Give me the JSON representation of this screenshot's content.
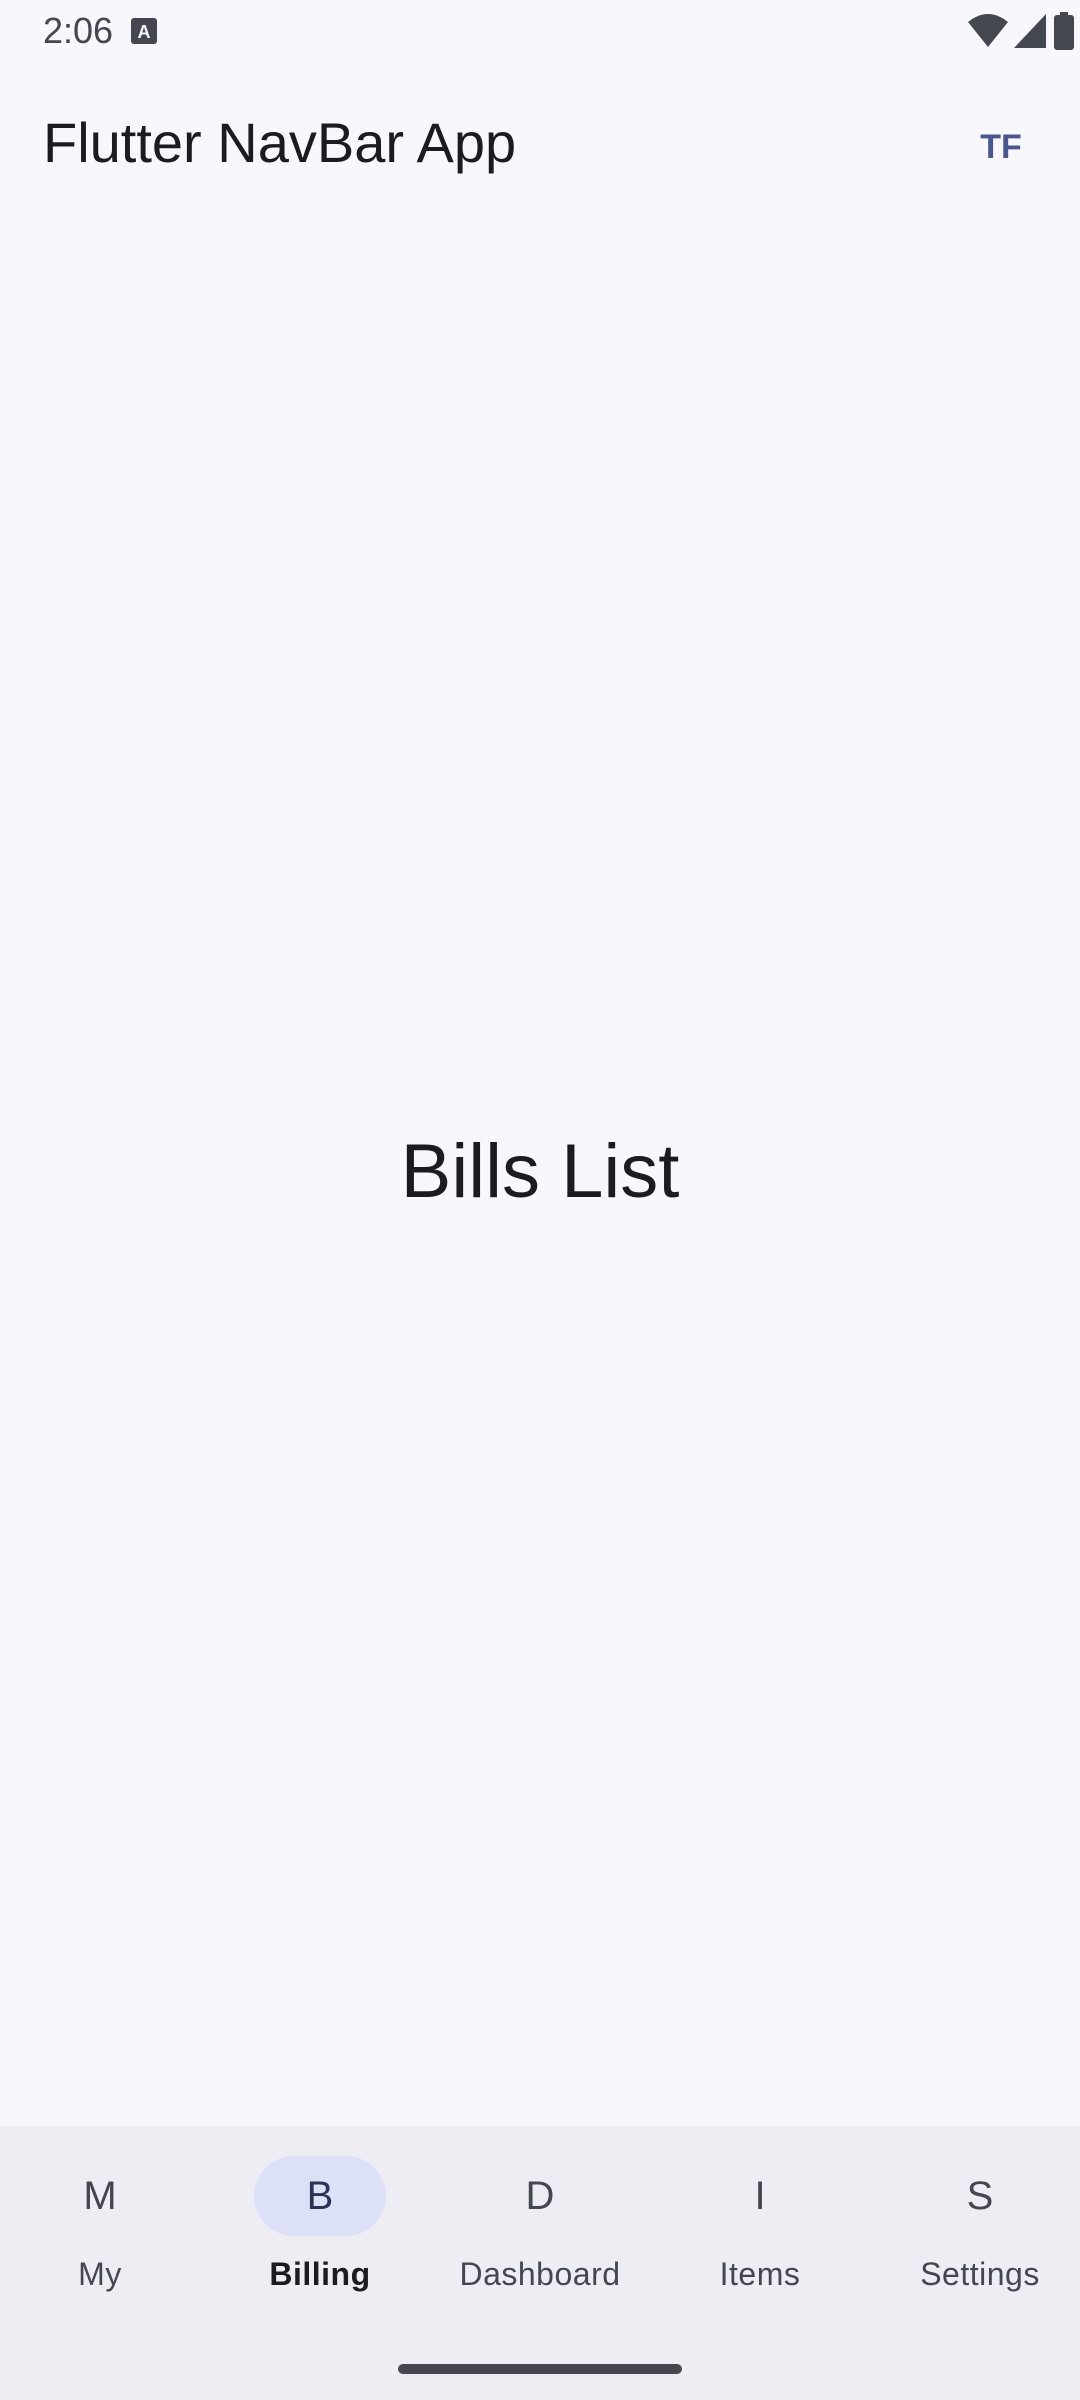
{
  "status_bar": {
    "time": "2:06",
    "icons": [
      "keyboard-a-icon",
      "wifi-icon",
      "signal-icon",
      "battery-icon"
    ]
  },
  "app_bar": {
    "title": "Flutter NavBar App",
    "action_label": "TF"
  },
  "main": {
    "text": "Bills List"
  },
  "bottom_nav": {
    "selected_index": 1,
    "items": [
      {
        "glyph": "M",
        "label": "My"
      },
      {
        "glyph": "B",
        "label": "Billing"
      },
      {
        "glyph": "D",
        "label": "Dashboard"
      },
      {
        "glyph": "I",
        "label": "Items"
      },
      {
        "glyph": "S",
        "label": "Settings"
      }
    ]
  },
  "colors": {
    "background": "#f8f7fd",
    "nav_background": "#eeedf4",
    "nav_indicator": "#dde1f8",
    "accent": "#4a5690"
  }
}
